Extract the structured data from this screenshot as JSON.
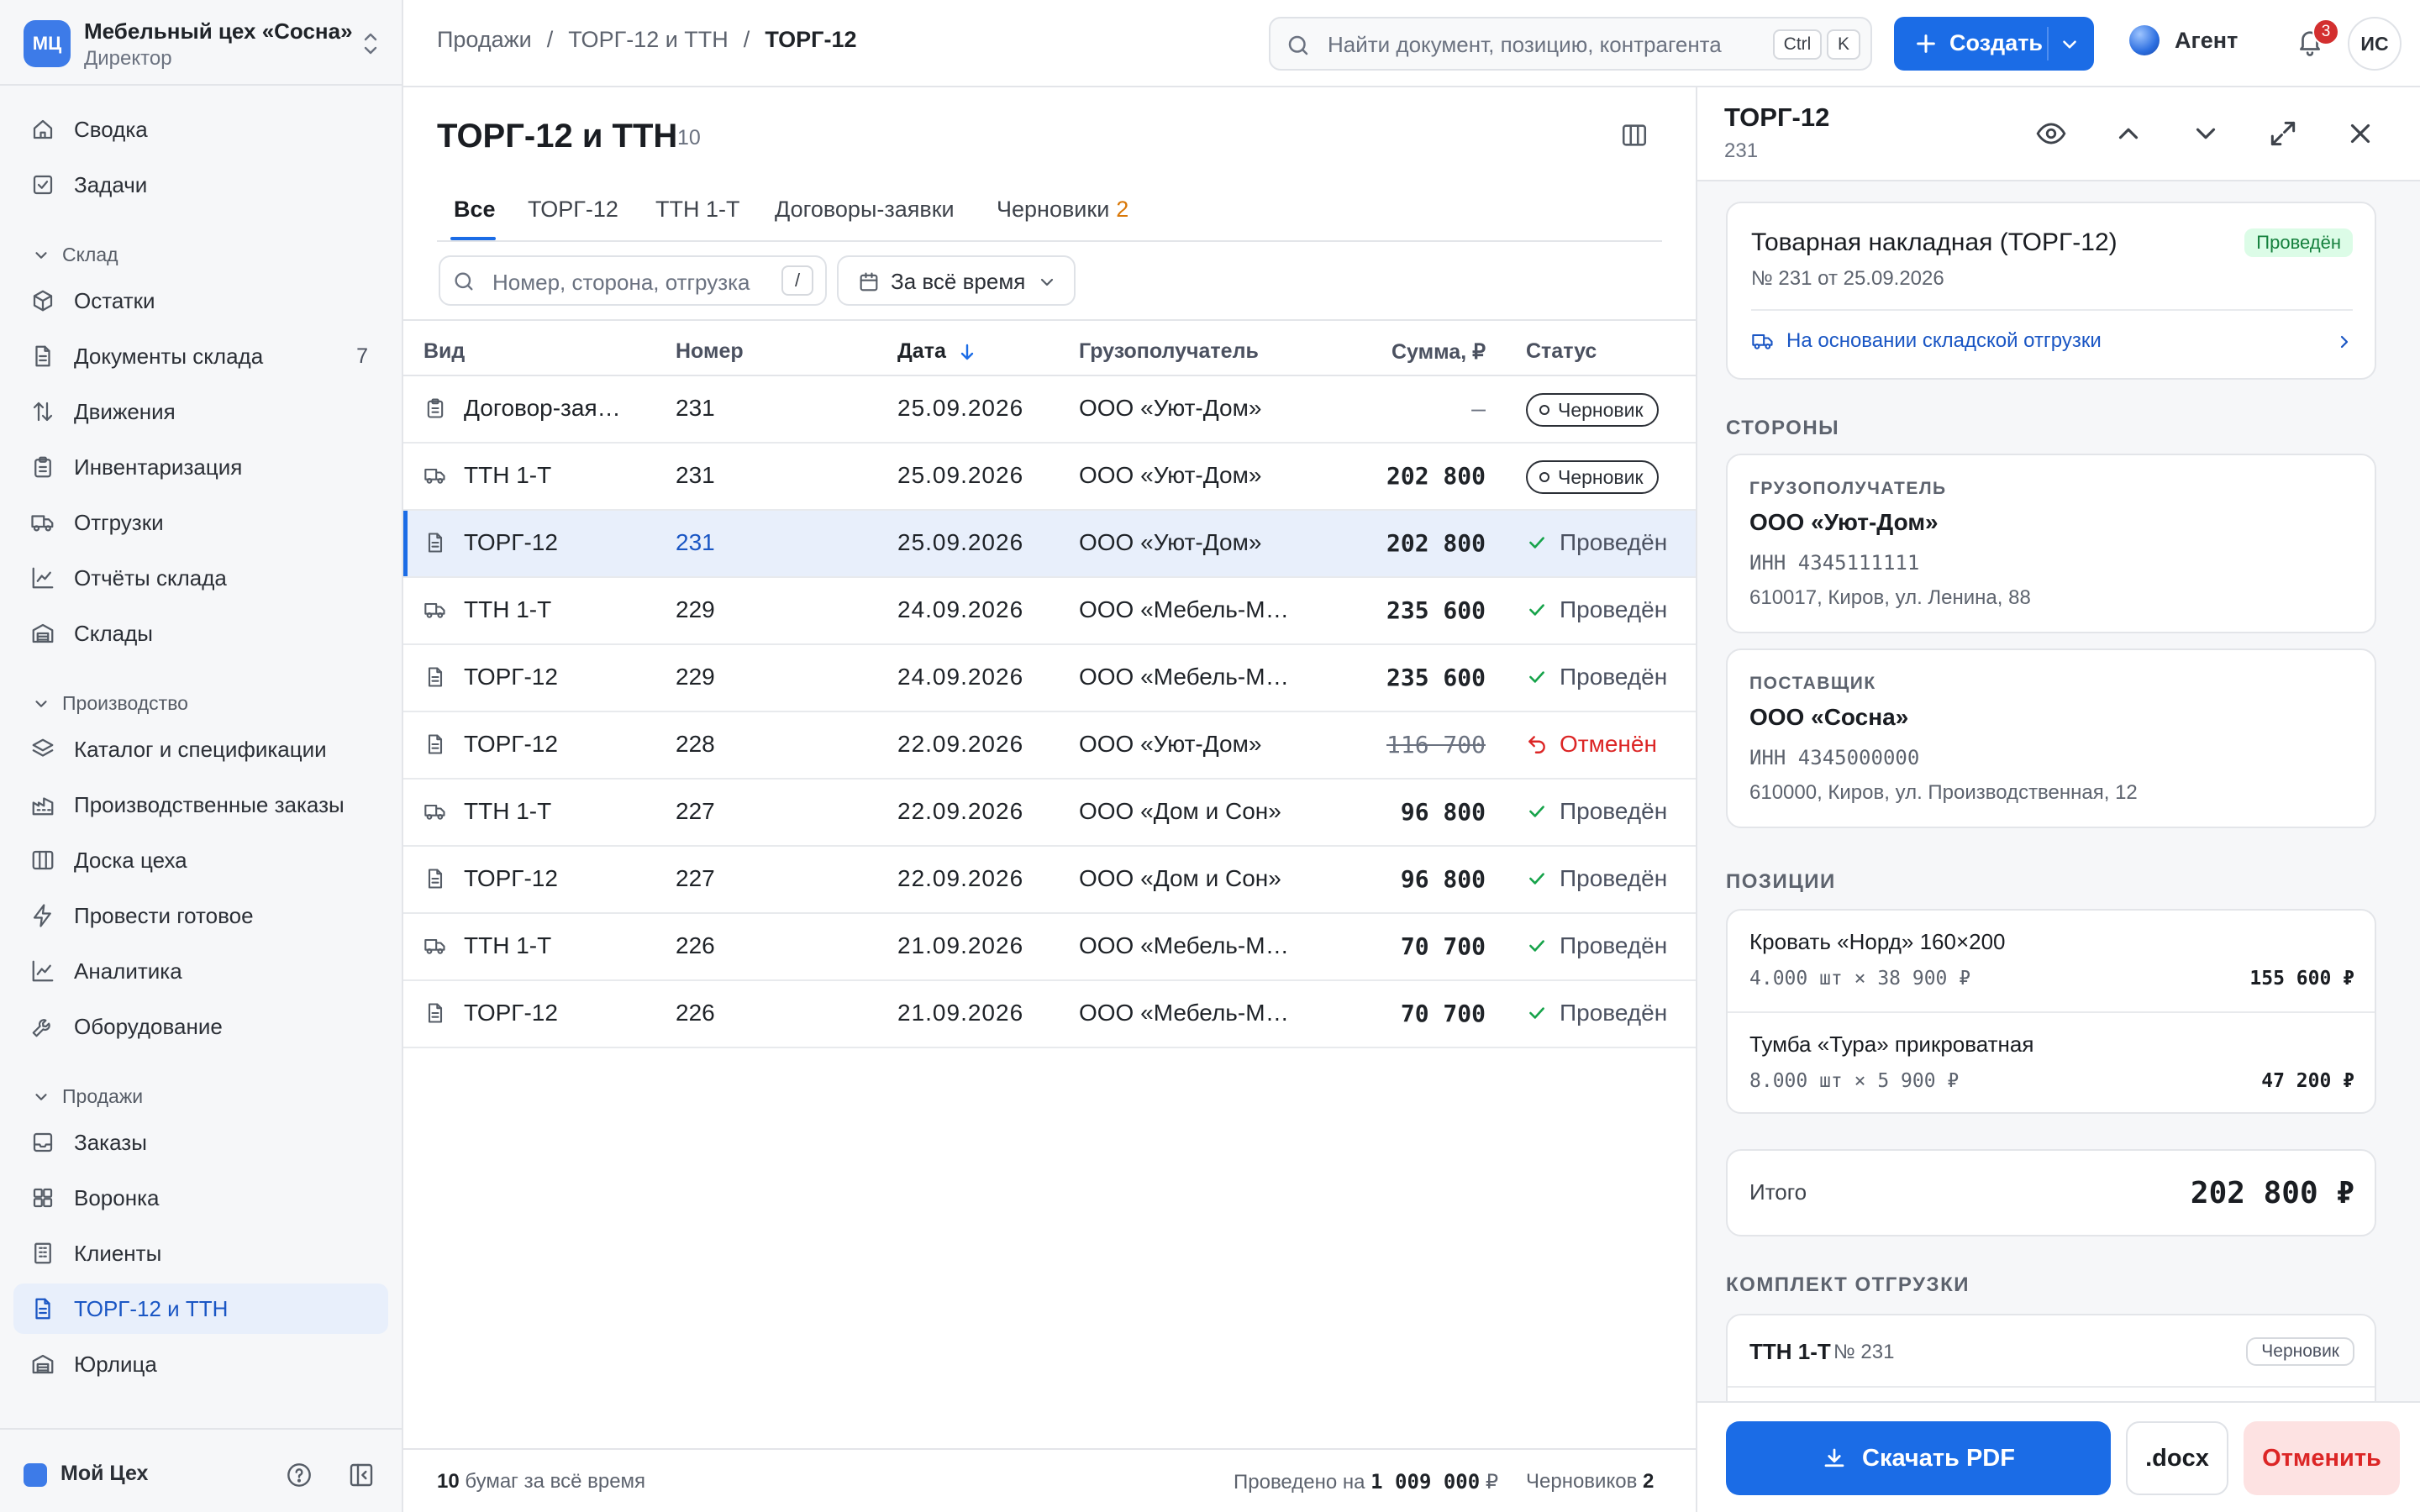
{
  "org": {
    "logo": "МЦ",
    "name": "Мебельный цех «Сосна»",
    "role": "Директор"
  },
  "sidebar": {
    "top": [
      {
        "label": "Сводка",
        "icon": "home-icon"
      },
      {
        "label": "Задачи",
        "icon": "checkbox-icon"
      }
    ],
    "sections": [
      {
        "title": "Склад",
        "items": [
          {
            "label": "Остатки",
            "icon": "box-icon"
          },
          {
            "label": "Документы склада",
            "icon": "document-icon",
            "count": "7"
          },
          {
            "label": "Движения",
            "icon": "arrows-updown-icon"
          },
          {
            "label": "Инвентаризация",
            "icon": "clipboard-icon"
          },
          {
            "label": "Отгрузки",
            "icon": "truck-icon"
          },
          {
            "label": "Отчёты склада",
            "icon": "line-chart-icon"
          },
          {
            "label": "Склады",
            "icon": "warehouse-icon"
          }
        ]
      },
      {
        "title": "Производство",
        "items": [
          {
            "label": "Каталог и спецификации",
            "icon": "layers-icon"
          },
          {
            "label": "Производственные заказы",
            "icon": "factory-icon"
          },
          {
            "label": "Доска цеха",
            "icon": "columns-icon"
          },
          {
            "label": "Провести готовое",
            "icon": "lightning-icon"
          },
          {
            "label": "Аналитика",
            "icon": "line-chart-icon"
          },
          {
            "label": "Оборудование",
            "icon": "wrench-icon"
          }
        ]
      },
      {
        "title": "Продажи",
        "items": [
          {
            "label": "Заказы",
            "icon": "inbox-icon"
          },
          {
            "label": "Воронка",
            "icon": "grid-icon"
          },
          {
            "label": "Клиенты",
            "icon": "building-icon"
          },
          {
            "label": "ТОРГ-12 и ТТН",
            "icon": "document-icon",
            "active": true
          },
          {
            "label": "Юрлица",
            "icon": "warehouse-icon"
          }
        ]
      }
    ],
    "workspace": "Мой Цех"
  },
  "topbar": {
    "breadcrumbs": [
      "Продажи",
      "ТОРГ-12 и ТТН",
      "ТОРГ-12"
    ],
    "search_placeholder": "Найти документ, позицию, контрагента",
    "search_keys": [
      "Ctrl",
      "K"
    ],
    "create_label": "Создать",
    "agent_label": "Агент",
    "notifications": "3",
    "avatar": "ИС",
    "accent": "#1b6ce6"
  },
  "list": {
    "title": "ТОРГ-12 и ТТН",
    "count": "10",
    "tabs": [
      {
        "label": "Все",
        "active": true
      },
      {
        "label": "ТОРГ-12"
      },
      {
        "label": "ТТН 1-Т"
      },
      {
        "label": "Договоры-заявки"
      },
      {
        "label": "Черновики",
        "badge": "2"
      }
    ],
    "filter_placeholder": "Номер, сторона, отгрузка",
    "filter_key": "/",
    "period": "За всё время",
    "columns": [
      "Вид",
      "Номер",
      "Дата",
      "Грузополучатель",
      "Сумма, ₽",
      "Статус"
    ],
    "rows": [
      {
        "icon": "clipboard-icon",
        "kind": "Договор-заявка",
        "num": "231",
        "date": "25.09.2026",
        "consignee": "ООО «Уют-Дом»",
        "sum": "—",
        "sum_style": "dash",
        "status": "Черновик",
        "status_type": "draft"
      },
      {
        "icon": "truck-icon",
        "kind": "ТТН 1-Т",
        "num": "231",
        "date": "25.09.2026",
        "consignee": "ООО «Уют-Дом»",
        "sum": "202 800",
        "status": "Черновик",
        "status_type": "draft"
      },
      {
        "icon": "document-icon",
        "kind": "ТОРГ-12",
        "num": "231",
        "date": "25.09.2026",
        "consignee": "ООО «Уют-Дом»",
        "sum": "202 800",
        "status": "Проведён",
        "status_type": "ok",
        "selected": true
      },
      {
        "icon": "truck-icon",
        "kind": "ТТН 1-Т",
        "num": "229",
        "date": "24.09.2026",
        "consignee": "ООО «Мебель-Маркет»",
        "sum": "235 600",
        "status": "Проведён",
        "status_type": "ok"
      },
      {
        "icon": "document-icon",
        "kind": "ТОРГ-12",
        "num": "229",
        "date": "24.09.2026",
        "consignee": "ООО «Мебель-Маркет»",
        "sum": "235 600",
        "status": "Проведён",
        "status_type": "ok"
      },
      {
        "icon": "document-icon",
        "kind": "ТОРГ-12",
        "num": "228",
        "date": "22.09.2026",
        "consignee": "ООО «Уют-Дом»",
        "sum": "116 700",
        "sum_style": "strike",
        "status": "Отменён",
        "status_type": "cancel"
      },
      {
        "icon": "truck-icon",
        "kind": "ТТН 1-Т",
        "num": "227",
        "date": "22.09.2026",
        "consignee": "ООО «Дом и Сон»",
        "sum": "96 800",
        "status": "Проведён",
        "status_type": "ok"
      },
      {
        "icon": "document-icon",
        "kind": "ТОРГ-12",
        "num": "227",
        "date": "22.09.2026",
        "consignee": "ООО «Дом и Сон»",
        "sum": "96 800",
        "status": "Проведён",
        "status_type": "ok"
      },
      {
        "icon": "truck-icon",
        "kind": "ТТН 1-Т",
        "num": "226",
        "date": "21.09.2026",
        "consignee": "ООО «Мебель-Маркет»",
        "sum": "70 700",
        "status": "Проведён",
        "status_type": "ok"
      },
      {
        "icon": "document-icon",
        "kind": "ТОРГ-12",
        "num": "226",
        "date": "21.09.2026",
        "consignee": "ООО «Мебель-Маркет»",
        "sum": "70 700",
        "status": "Проведён",
        "status_type": "ok"
      }
    ],
    "footer": {
      "count": "10",
      "count_text": "бумаг за всё время",
      "posted_text": "Проведено на",
      "posted_sum": "1 009 000",
      "currency": "₽",
      "drafts_text": "Черновиков",
      "drafts": "2"
    }
  },
  "panel": {
    "title": "ТОРГ-12",
    "subtitle": "231",
    "doc": {
      "title": "Товарная накладная (ТОРГ-12)",
      "status": "Проведён",
      "meta": "№ 231  от 25.09.2026",
      "basis": "На основании складской отгрузки"
    },
    "parties_title": "СТОРОНЫ",
    "consignee": {
      "label": "ГРУЗОПОЛУЧАТЕЛЬ",
      "name": "ООО «Уют-Дом»",
      "inn": "ИНН 4345111111",
      "address": "610017, Киров, ул. Ленина, 88"
    },
    "supplier": {
      "label": "ПОСТАВЩИК",
      "name": "ООО «Сосна»",
      "inn": "ИНН 4345000000",
      "address": "610000, Киров, ул. Производственная, 12"
    },
    "positions_title": "ПОЗИЦИИ",
    "positions": [
      {
        "name": "Кровать «Норд» 160×200",
        "qty": "4.000 шт × 38 900 ₽",
        "total": "155 600 ₽"
      },
      {
        "name": "Тумба «Тура» прикроватная",
        "qty": "8.000 шт × 5 900 ₽",
        "total": "47 200 ₽"
      }
    ],
    "total_label": "Итого",
    "total_value": "202 800 ₽",
    "kit_title": "КОМПЛЕКТ ОТГРУЗКИ",
    "kit": {
      "name": "ТТН 1-Т",
      "num": "№ 231",
      "status": "Черновик"
    },
    "actions": {
      "pdf": "Скачать PDF",
      "docx": ".docx",
      "cancel": "Отменить"
    }
  }
}
